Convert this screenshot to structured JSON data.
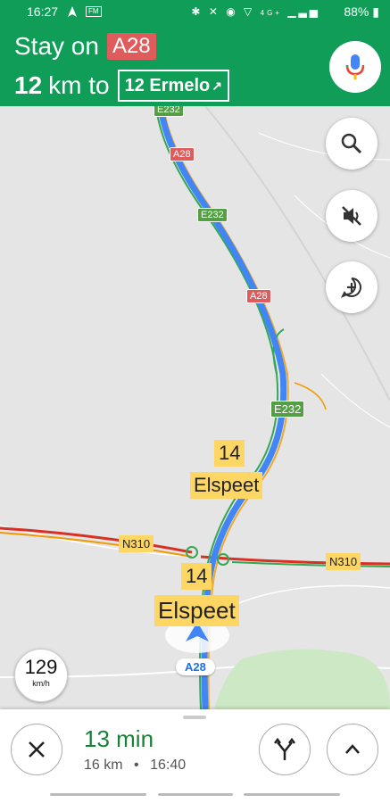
{
  "status_bar": {
    "time": "16:27",
    "fm_badge": "FM",
    "signal_text": "4G+",
    "battery": "88%"
  },
  "header": {
    "instruction_prefix": "Stay on",
    "road": "A28",
    "distance_value": "12",
    "distance_unit": "km to",
    "exit_sign": "12 Ermelo",
    "exit_arrow": "↗"
  },
  "map": {
    "shields": [
      "E232",
      "A28",
      "E232",
      "A28",
      "E232"
    ],
    "roads": [
      "N310",
      "N310"
    ],
    "exit_number": "14",
    "exit_place": "Elspeet",
    "current_road": "A28"
  },
  "speed": {
    "value": "129",
    "unit": "km/h"
  },
  "trip": {
    "duration": "13 min",
    "distance": "16 km",
    "separator": "•",
    "arrival": "16:40"
  },
  "colors": {
    "header_green": "#0f9d58",
    "route_blue": "#4285f4",
    "eta_green": "#188038",
    "a_road_red": "#e05b5b",
    "e_road_green": "#52a043",
    "label_yellow": "#fdd663"
  }
}
